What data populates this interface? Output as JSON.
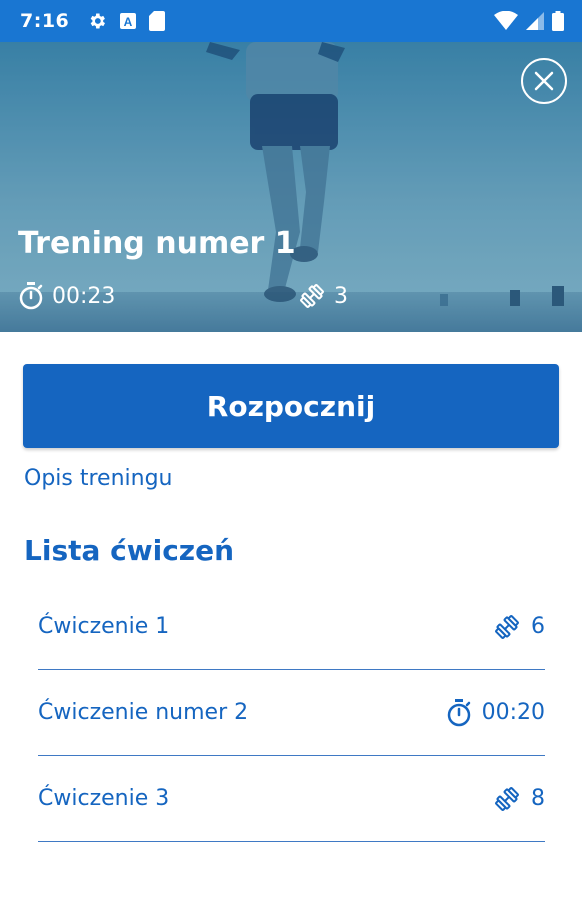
{
  "status_bar": {
    "time": "7:16",
    "left_icons": [
      "gear-icon",
      "a-box-icon",
      "sd-card-icon"
    ],
    "right_icons": [
      "wifi-icon",
      "signal-icon",
      "battery-icon"
    ]
  },
  "hero": {
    "title": "Trening numer 1",
    "duration": "00:23",
    "exercise_count": "3"
  },
  "actions": {
    "start_label": "Rozpocznij",
    "description_link": "Opis treningu"
  },
  "exercises": {
    "section_title": "Lista ćwiczeń",
    "items": [
      {
        "name": "Ćwiczenie 1",
        "type": "reps",
        "icon": "dumbbell-icon",
        "value": "6"
      },
      {
        "name": "Ćwiczenie numer 2",
        "type": "time",
        "icon": "stopwatch-icon",
        "value": "00:20"
      },
      {
        "name": "Ćwiczenie 3",
        "type": "reps",
        "icon": "dumbbell-icon",
        "value": "8"
      }
    ]
  },
  "colors": {
    "primary": "#1565c0",
    "status_bar": "#1976d2"
  }
}
